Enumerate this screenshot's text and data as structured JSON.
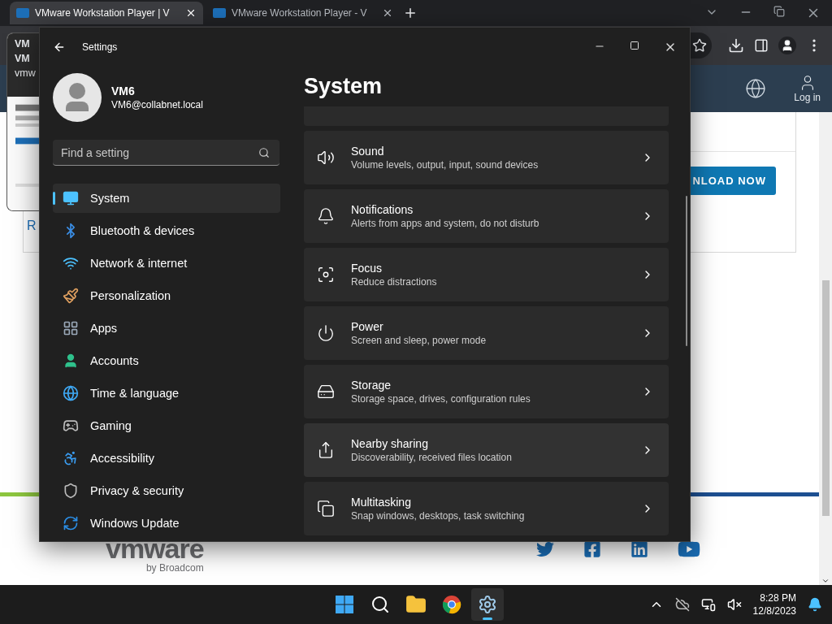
{
  "browser": {
    "tabs": [
      {
        "title": "VMware Workstation Player | V",
        "selected": true
      },
      {
        "title": "VMware Workstation Player - V",
        "selected": false
      }
    ],
    "hover_card": {
      "lines": [
        "VM",
        "VM",
        "vmw"
      ]
    },
    "page": {
      "login": "Log in",
      "download_button": "NLOAD NOW",
      "behind_text": "R",
      "footer_brand": "vmware",
      "footer_sub": "by Broadcom"
    }
  },
  "settings": {
    "title": "Settings",
    "user": {
      "name": "VM6",
      "email": "VM6@collabnet.local"
    },
    "search": {
      "placeholder": "Find a setting"
    },
    "nav": [
      {
        "kind": "system",
        "label": "System",
        "selected": true
      },
      {
        "kind": "bluetooth",
        "label": "Bluetooth & devices",
        "selected": false
      },
      {
        "kind": "network",
        "label": "Network & internet",
        "selected": false
      },
      {
        "kind": "personalization",
        "label": "Personalization",
        "selected": false
      },
      {
        "kind": "apps",
        "label": "Apps",
        "selected": false
      },
      {
        "kind": "accounts",
        "label": "Accounts",
        "selected": false
      },
      {
        "kind": "time",
        "label": "Time & language",
        "selected": false
      },
      {
        "kind": "gaming",
        "label": "Gaming",
        "selected": false
      },
      {
        "kind": "accessibility",
        "label": "Accessibility",
        "selected": false
      },
      {
        "kind": "privacy",
        "label": "Privacy & security",
        "selected": false
      },
      {
        "kind": "update",
        "label": "Windows Update",
        "selected": false
      }
    ],
    "heading": "System",
    "cards": [
      {
        "kind": "sound",
        "title": "Sound",
        "subtitle": "Volume levels, output, input, sound devices"
      },
      {
        "kind": "notifications",
        "title": "Notifications",
        "subtitle": "Alerts from apps and system, do not disturb"
      },
      {
        "kind": "focus",
        "title": "Focus",
        "subtitle": "Reduce distractions"
      },
      {
        "kind": "power",
        "title": "Power",
        "subtitle": "Screen and sleep, power mode"
      },
      {
        "kind": "storage",
        "title": "Storage",
        "subtitle": "Storage space, drives, configuration rules"
      },
      {
        "kind": "sharing",
        "title": "Nearby sharing",
        "subtitle": "Discoverability, received files location"
      },
      {
        "kind": "multitasking",
        "title": "Multitasking",
        "subtitle": "Snap windows, desktops, task switching"
      }
    ]
  },
  "taskbar": {
    "apps": [
      {
        "kind": "start",
        "selected": false
      },
      {
        "kind": "search",
        "selected": false
      },
      {
        "kind": "explorer",
        "selected": false
      },
      {
        "kind": "chrome",
        "selected": false
      },
      {
        "kind": "settings",
        "selected": true
      }
    ],
    "time": "8:28 PM",
    "date": "12/8/2023"
  }
}
